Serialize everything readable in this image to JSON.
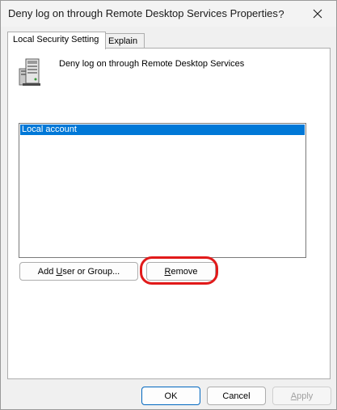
{
  "window": {
    "title": "Deny log on through Remote Desktop Services Properties",
    "help_label": "?"
  },
  "tabs": [
    {
      "label": "Local Security Setting",
      "active": true
    },
    {
      "label": "Explain",
      "active": false
    }
  ],
  "policy": {
    "icon": "server-computer-icon",
    "title": "Deny log on through Remote Desktop Services"
  },
  "accounts": {
    "items": [
      "Local account"
    ],
    "selected_index": 0
  },
  "buttons": {
    "add_prefix": "Add ",
    "add_underlined": "U",
    "add_suffix": "ser or Group...",
    "remove_underlined": "R",
    "remove_suffix": "emove",
    "ok": "OK",
    "cancel": "Cancel",
    "apply_underlined": "A",
    "apply_suffix": "pply"
  },
  "colors": {
    "accent": "#0078d7",
    "highlight_annotation": "#e11a1a"
  }
}
